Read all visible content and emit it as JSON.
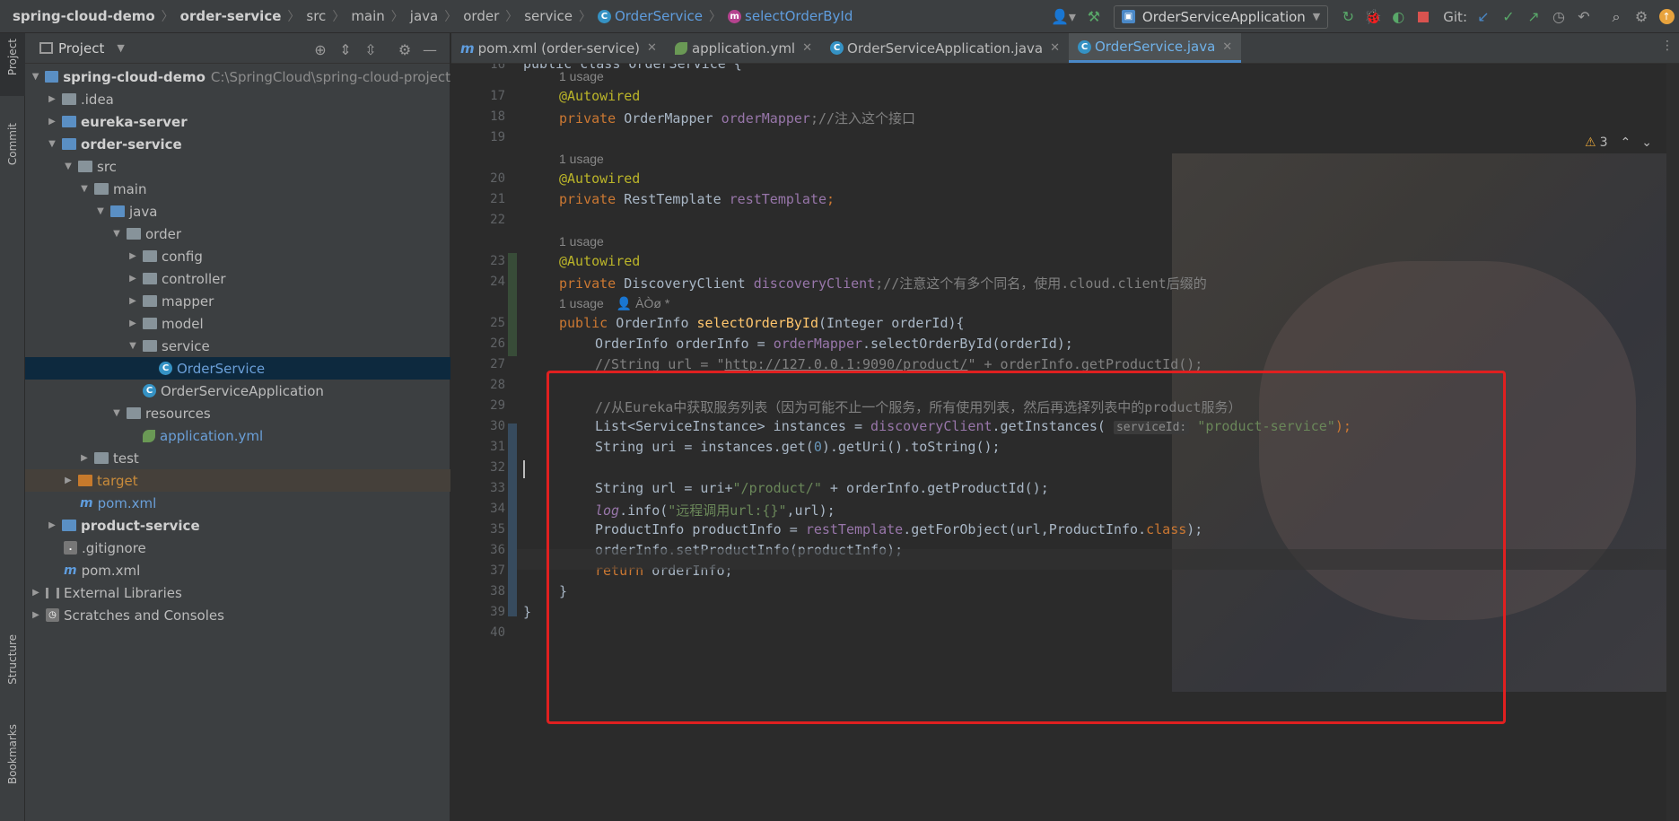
{
  "breadcrumbs": [
    "spring-cloud-demo",
    "order-service",
    "src",
    "main",
    "java",
    "order",
    "service",
    "OrderService",
    "selectOrderById"
  ],
  "toolbar": {
    "run_config": "OrderServiceApplication",
    "git_label": "Git:"
  },
  "left_stripe": {
    "project": "Project",
    "commit": "Commit",
    "structure": "Structure",
    "bookmarks": "Bookmarks"
  },
  "project_panel": {
    "title": "Project",
    "tree": {
      "root": "spring-cloud-demo",
      "root_path": "C:\\SpringCloud\\spring-cloud-project",
      "idea": ".idea",
      "eureka": "eureka-server",
      "order": "order-service",
      "src": "src",
      "main": "main",
      "java": "java",
      "order_pkg": "order",
      "config": "config",
      "controller": "controller",
      "mapper": "mapper",
      "model": "model",
      "service": "service",
      "order_service": "OrderService",
      "app": "OrderServiceApplication",
      "resources": "resources",
      "app_yml": "application.yml",
      "test": "test",
      "target": "target",
      "pom_order": "pom.xml",
      "product": "product-service",
      "gitignore": ".gitignore",
      "pom_root": "pom.xml",
      "ext_libs": "External Libraries",
      "scratches": "Scratches and Consoles"
    }
  },
  "tabs": [
    {
      "label": "pom.xml (order-service)",
      "active": false
    },
    {
      "label": "application.yml",
      "active": false
    },
    {
      "label": "OrderServiceApplication.java",
      "active": false
    },
    {
      "label": "OrderService.java",
      "active": true
    }
  ],
  "inspections": {
    "warnings": "3"
  },
  "editor": {
    "line_numbers": [
      "16",
      "17",
      "18",
      "19",
      "20",
      "21",
      "22",
      "23",
      "24",
      "25",
      "26",
      "27",
      "28",
      "29",
      "30",
      "31",
      "32",
      "33",
      "34",
      "35",
      "36",
      "37",
      "38",
      "39",
      "40"
    ],
    "usage_1": "1 usage",
    "usage_2": "1 usage",
    "usage_3": "1 usage",
    "usage_4": "1 usage",
    "usage_4_author": "ÀÒø *",
    "l16": "public class OrderService {",
    "l17": "@Autowired",
    "l18_kw": "private",
    "l18_type": " OrderMapper ",
    "l18_fld": "orderMapper",
    "l18_cm": ";//注入这个接口",
    "l20": "@Autowired",
    "l21_kw": "private",
    "l21_type": " RestTemplate ",
    "l21_fld": "restTemplate",
    "l21_end": ";",
    "l23": "@Autowired",
    "l24_kw": "private",
    "l24_type": " DiscoveryClient ",
    "l24_fld": "discoveryClient",
    "l24_cm": ";//注意这个有多个同名，使用.cloud.client后缀的",
    "l25_kw": "public",
    "l25_type": " OrderInfo ",
    "l25_fn": "selectOrderById",
    "l25_rest": "(Integer orderId){",
    "l26_a": "OrderInfo orderInfo = ",
    "l26_fld": "orderMapper",
    "l26_b": ".selectOrderById(orderId);",
    "l27_a": "//String url = \"",
    "l27_url": "http://127.0.0.1:9090/product/",
    "l27_b": "\" + orderInfo.getProductId();",
    "l29": "//从Eureka中获取服务列表（因为可能不止一个服务，所有使用列表，然后再选择列表中的product服务）",
    "l30_a": "List<ServiceInstance> instances = ",
    "l30_fld": "discoveryClient",
    "l30_b": ".getInstances( ",
    "l30_hint": "serviceId:",
    "l30_str": " \"product-service\"",
    "l30_c": ");",
    "l31_a": "String uri = instances.get(",
    "l31_num": "0",
    "l31_b": ").getUri().toString();",
    "l33_a": "String url = uri+",
    "l33_str": "\"/product/\"",
    "l33_b": " + orderInfo.getProductId();",
    "l34_fld": "log",
    "l34_a": ".info(",
    "l34_str": "\"远程调用url:{}\"",
    "l34_b": ",url);",
    "l35_a": "ProductInfo productInfo = ",
    "l35_fld": "restTemplate",
    "l35_b": ".getForObject(url,ProductInfo.",
    "l35_kw": "class",
    "l35_c": ");",
    "l36": "orderInfo.setProductInfo(productInfo);",
    "l37_kw": "return",
    "l37_b": " orderInfo;",
    "l38": "}",
    "l39": "}"
  }
}
